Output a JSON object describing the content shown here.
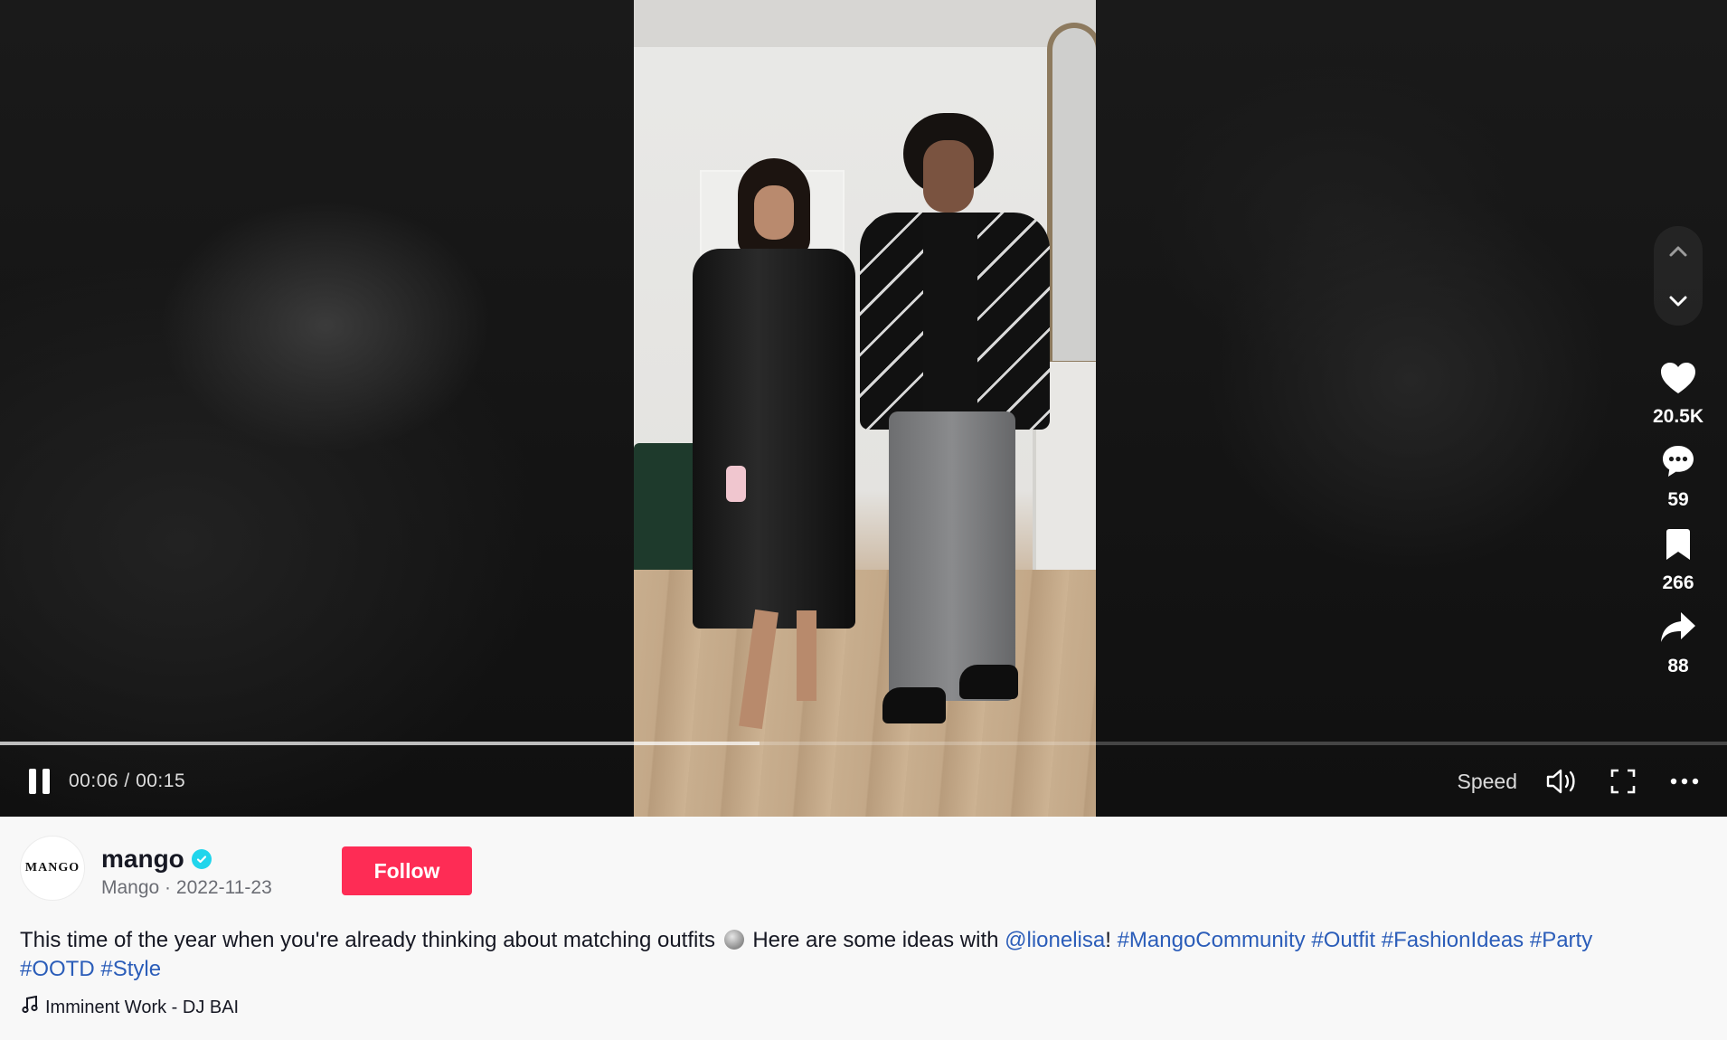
{
  "player": {
    "current_time": "00:06",
    "duration": "00:15",
    "time_separator": " / ",
    "progress_fraction": 0.44,
    "speed_label": "Speed"
  },
  "actions": {
    "likes": "20.5K",
    "comments": "59",
    "saves": "266",
    "shares": "88"
  },
  "author": {
    "handle": "mango",
    "avatar_text": "MANGO",
    "nickname": "Mango",
    "date": "2022-11-23",
    "sub_separator": " · "
  },
  "follow_label": "Follow",
  "caption": {
    "text_before_emoji": "This time of the year when you're already thinking about matching outfits",
    "text_after_emoji": " Here are some ideas with ",
    "mention": "@lionelisa",
    "exclamation": "! ",
    "hashtags": [
      "#MangoCommunity",
      "#Outfit",
      "#FashionIdeas",
      "#Party",
      "#OOTD",
      "#Style"
    ]
  },
  "music": "Imminent Work - DJ BAI",
  "colors": {
    "follow_button": "#fe2c55",
    "link": "#2b5db9",
    "verified_badge": "#20d5ec"
  },
  "icons": [
    "pause-icon",
    "volume-icon",
    "fullscreen-icon",
    "more-icon",
    "chevron-up-icon",
    "chevron-down-icon",
    "heart-icon",
    "comment-icon",
    "bookmark-icon",
    "share-icon",
    "verified-icon",
    "music-note-icon",
    "disco-ball-icon"
  ]
}
